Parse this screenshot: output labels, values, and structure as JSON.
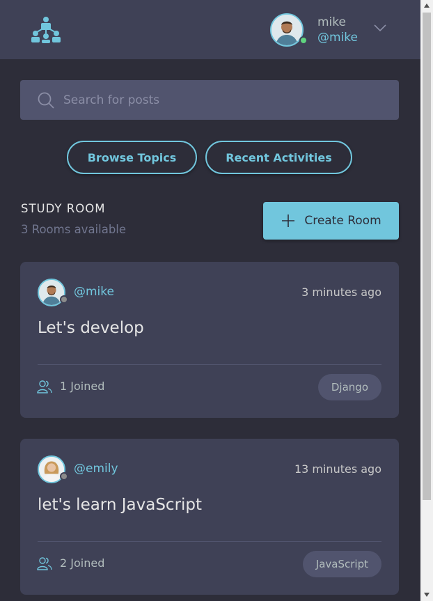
{
  "header": {
    "logo_icon": "people-network-logo-icon",
    "user": {
      "name": "mike",
      "handle": "@mike",
      "status": "online",
      "avatar_icon": "avatar-mike"
    },
    "menu_icon": "chevron-down-icon"
  },
  "search": {
    "placeholder": "Search for posts",
    "value": "",
    "icon": "search-icon"
  },
  "nav_buttons": {
    "browse_topics": "Browse Topics",
    "recent_activities": "Recent Activities"
  },
  "study_room": {
    "title": "STUDY ROOM",
    "subtitle": "3 Rooms available",
    "create_label": "Create Room"
  },
  "rooms": [
    {
      "host": "@mike",
      "time": "3 minutes ago",
      "title": "Let's develop",
      "joined": "1 Joined",
      "topic": "Django"
    },
    {
      "host": "@emily",
      "time": "13 minutes ago",
      "title": "let's learn JavaScript",
      "joined": "2 Joined",
      "topic": "JavaScript"
    }
  ],
  "colors": {
    "background": "#2d2d39",
    "panel": "#3f4156",
    "accent": "#71c6dd",
    "online": "#5fd47f"
  }
}
